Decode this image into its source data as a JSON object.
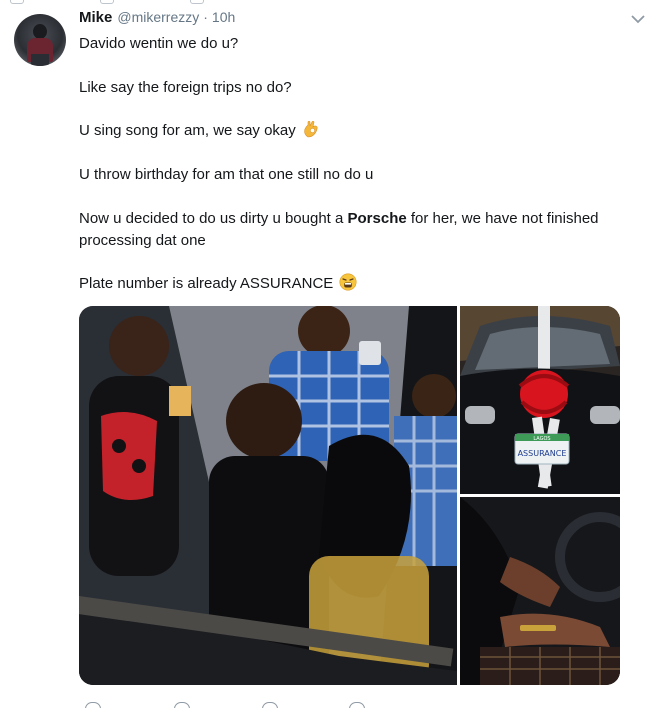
{
  "tweet": {
    "display_name": "Mike",
    "handle": "@mikerrezzy",
    "separator": "·",
    "time": "10h",
    "lines": [
      "Davido wentin we do u?",
      "Like say the foreign trips no do?",
      "U sing song for am, we say okay",
      "U throw birthday for am that one still no do u"
    ],
    "porsche_line": {
      "before": "Now u decided to do us dirty u bought a ",
      "bold": "Porsche",
      "after": " for her, we have not finished"
    },
    "porsche_line_2": "processing dat one",
    "plate_line": "Plate number is already ASSURANCE",
    "plate_text": "ASSURANCE",
    "plate_state": "LAGOS",
    "emojis": [
      "ok-hand-emoji",
      "tired-face-emoji"
    ]
  },
  "colors": {
    "text": "#14171a",
    "secondary": "#657786",
    "icon": "#8f9aa4",
    "bow_red": "#d8141e",
    "shirt_blue": "#2f63b5"
  },
  "icons": [
    "avatar",
    "caret-down-icon",
    "reply-icon",
    "retweet-icon",
    "like-icon",
    "dm-icon"
  ]
}
